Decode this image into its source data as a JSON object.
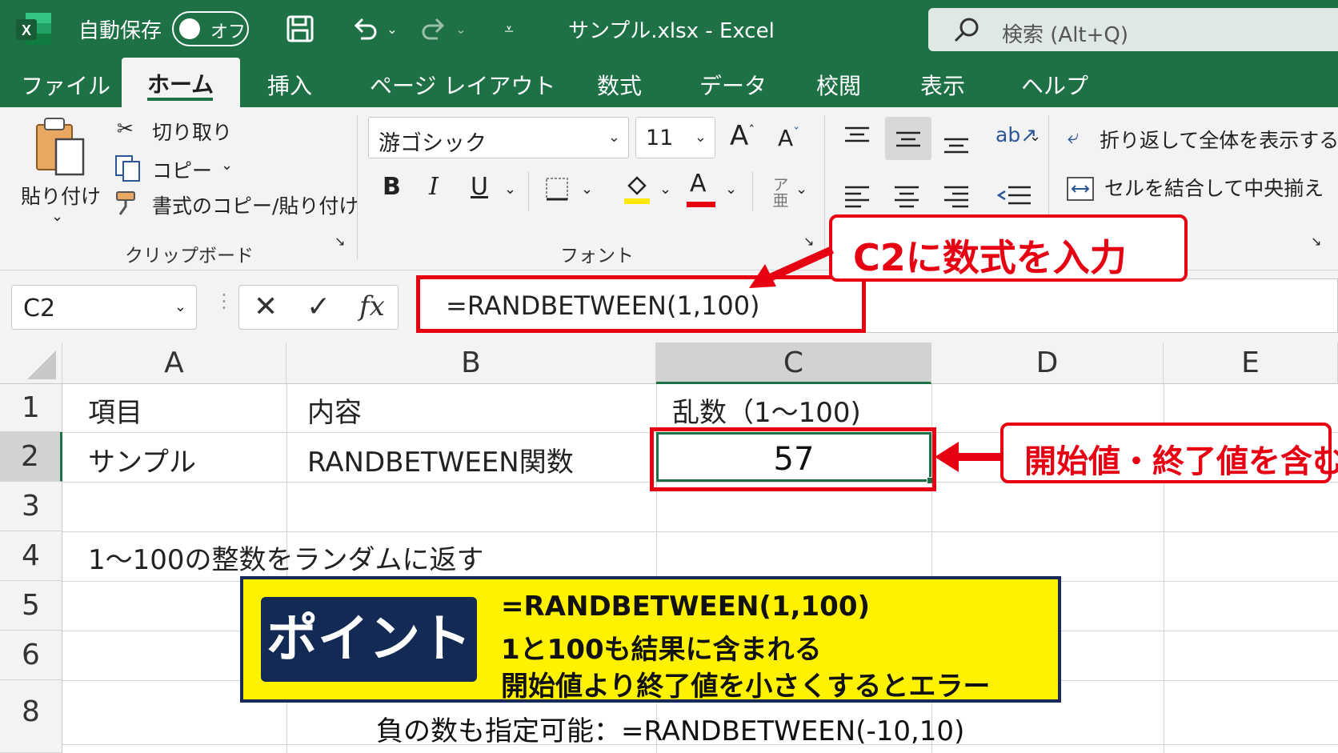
{
  "titlebar": {
    "autosave_label": "自動保存",
    "autosave_state": "オフ",
    "file_title": "サンプル.xlsx  -  Excel",
    "search_placeholder": "検索 (Alt+Q)"
  },
  "tabs": {
    "file": "ファイル",
    "home": "ホーム",
    "insert": "挿入",
    "page_layout": "ページ レイアウト",
    "formulas": "数式",
    "data": "データ",
    "review": "校閲",
    "view": "表示",
    "help": "ヘルプ"
  },
  "clipboard": {
    "paste": "貼り付け",
    "cut": "切り取り",
    "copy": "コピー",
    "format_painter": "書式のコピー/貼り付け",
    "group_label": "クリップボード"
  },
  "font": {
    "font_name": "游ゴシック",
    "font_size": "11",
    "bold": "B",
    "italic": "I",
    "underline": "U",
    "font_color_glyph": "A",
    "group_label": "フォント"
  },
  "alignment": {
    "wrap_text": "折り返して全体を表示する",
    "merge_center": "セルを結合して中央揃え"
  },
  "formula_bar": {
    "name_box": "C2",
    "fx": "fx",
    "formula": "=RANDBETWEEN(1,100)"
  },
  "columns": [
    "A",
    "B",
    "C",
    "D",
    "E"
  ],
  "rows": [
    "1",
    "2",
    "3",
    "4",
    "5",
    "6",
    "8"
  ],
  "cells": {
    "A1": "項目",
    "B1": "内容",
    "C1": "乱数（1～100)",
    "A2": "サンプル",
    "B2": "RANDBETWEEN関数",
    "C2": "57",
    "A4": "1～100の整数をランダムに返す"
  },
  "annotations": {
    "formula_callout": "C2に数式を入力",
    "cell_callout": "開始値・終了値を含む",
    "point_label": "ポイント",
    "point_lines": [
      "=RANDBETWEEN(1,100)",
      "1と100も結果に含まれる",
      "開始値より終了値を小さくするとエラー"
    ],
    "note": "負の数も指定可能：=RANDBETWEEN(-10,10)"
  },
  "colors": {
    "excel_green": "#1e7145",
    "annotation_red": "#e60012",
    "point_yellow": "#fff200",
    "point_navy": "#132a55"
  }
}
